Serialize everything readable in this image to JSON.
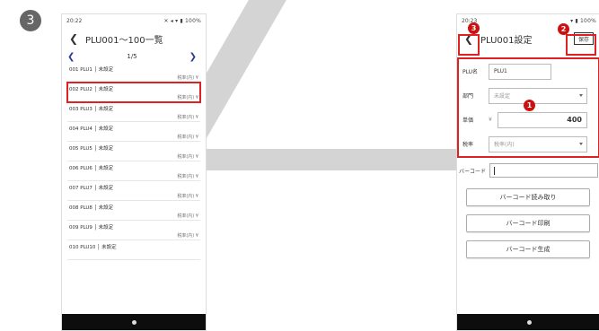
{
  "step_number": "3",
  "left_phone": {
    "status_time": "20:22",
    "status_right": "✕ ◂ ▾ ▮ 100%",
    "title": "PLU001〜100一覧",
    "pager_text": "1/5",
    "rows": [
      {
        "label": "001 PLU1 │ 未設定",
        "tax": "税率(内) ¥"
      },
      {
        "label": "002 PLU2 │ 未設定",
        "tax": "税率(内) ¥"
      },
      {
        "label": "003 PLU3 │ 未設定",
        "tax": "税率(内) ¥"
      },
      {
        "label": "004 PLU4 │ 未設定",
        "tax": "税率(内) ¥"
      },
      {
        "label": "005 PLU5 │ 未設定",
        "tax": "税率(内) ¥"
      },
      {
        "label": "006 PLU6 │ 未設定",
        "tax": "税率(内) ¥"
      },
      {
        "label": "007 PLU7 │ 未設定",
        "tax": "税率(内) ¥"
      },
      {
        "label": "008 PLU8 │ 未設定",
        "tax": "税率(内) ¥"
      },
      {
        "label": "009 PLU9 │ 未設定",
        "tax": "税率(内) ¥"
      },
      {
        "label": "010 PLU10 │ 未設定",
        "tax": ""
      }
    ]
  },
  "right_phone": {
    "status_time": "20:23",
    "status_right": "▾ ▮ 100%",
    "title": "PLU001設定",
    "save_label": "保存",
    "fields": {
      "plu_name_label": "PLU名",
      "plu_name_value": "PLU1",
      "dept_label": "部門",
      "dept_placeholder": "未設定",
      "price_label": "単価",
      "price_currency": "¥",
      "price_value": "400",
      "tax_label": "税率",
      "tax_value": "税率(内)"
    },
    "barcode_label": "バーコード",
    "buttons": {
      "read": "バーコード読み取り",
      "print": "バーコード印刷",
      "generate": "バーコード生成"
    }
  },
  "callouts": {
    "one": "1",
    "two": "2",
    "three": "3"
  },
  "colors": {
    "highlight": "#d22222",
    "callout": "#cc1111",
    "step": "#666666"
  }
}
